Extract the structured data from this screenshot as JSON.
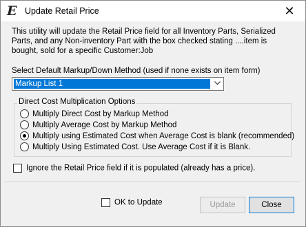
{
  "window": {
    "title": "Update Retail Price",
    "icon": "E",
    "close_glyph": "✕"
  },
  "description": "This utility will update the Retail Price field for all Inventory Parts, Serialized Parts, and any Non-inventory Part with the box checked stating ....item is bought, sold for a specific Customer:Job",
  "markup": {
    "label": "Select Default Markup/Down Method (used if none exists on item form)",
    "selected": "Markup List 1"
  },
  "group": {
    "title": "Direct Cost Multiplication Options",
    "options": [
      {
        "label": "Multiply Direct Cost by Markup Method",
        "checked": false
      },
      {
        "label": "Multiply Average Cost by Markup Method",
        "checked": false
      },
      {
        "label": "Multiply using Estimated Cost when Average Cost is blank (recommended)",
        "checked": true
      },
      {
        "label": "Multiply Using Estimated Cost. Use Average Cost if it is Blank.",
        "checked": false
      }
    ]
  },
  "ignore_checkbox": {
    "label": "Ignore the Retail Price field if it is populated (already has a price).",
    "checked": false
  },
  "ok_to_update": {
    "label": "OK to Update",
    "checked": false
  },
  "buttons": {
    "update": "Update",
    "close": "Close"
  }
}
